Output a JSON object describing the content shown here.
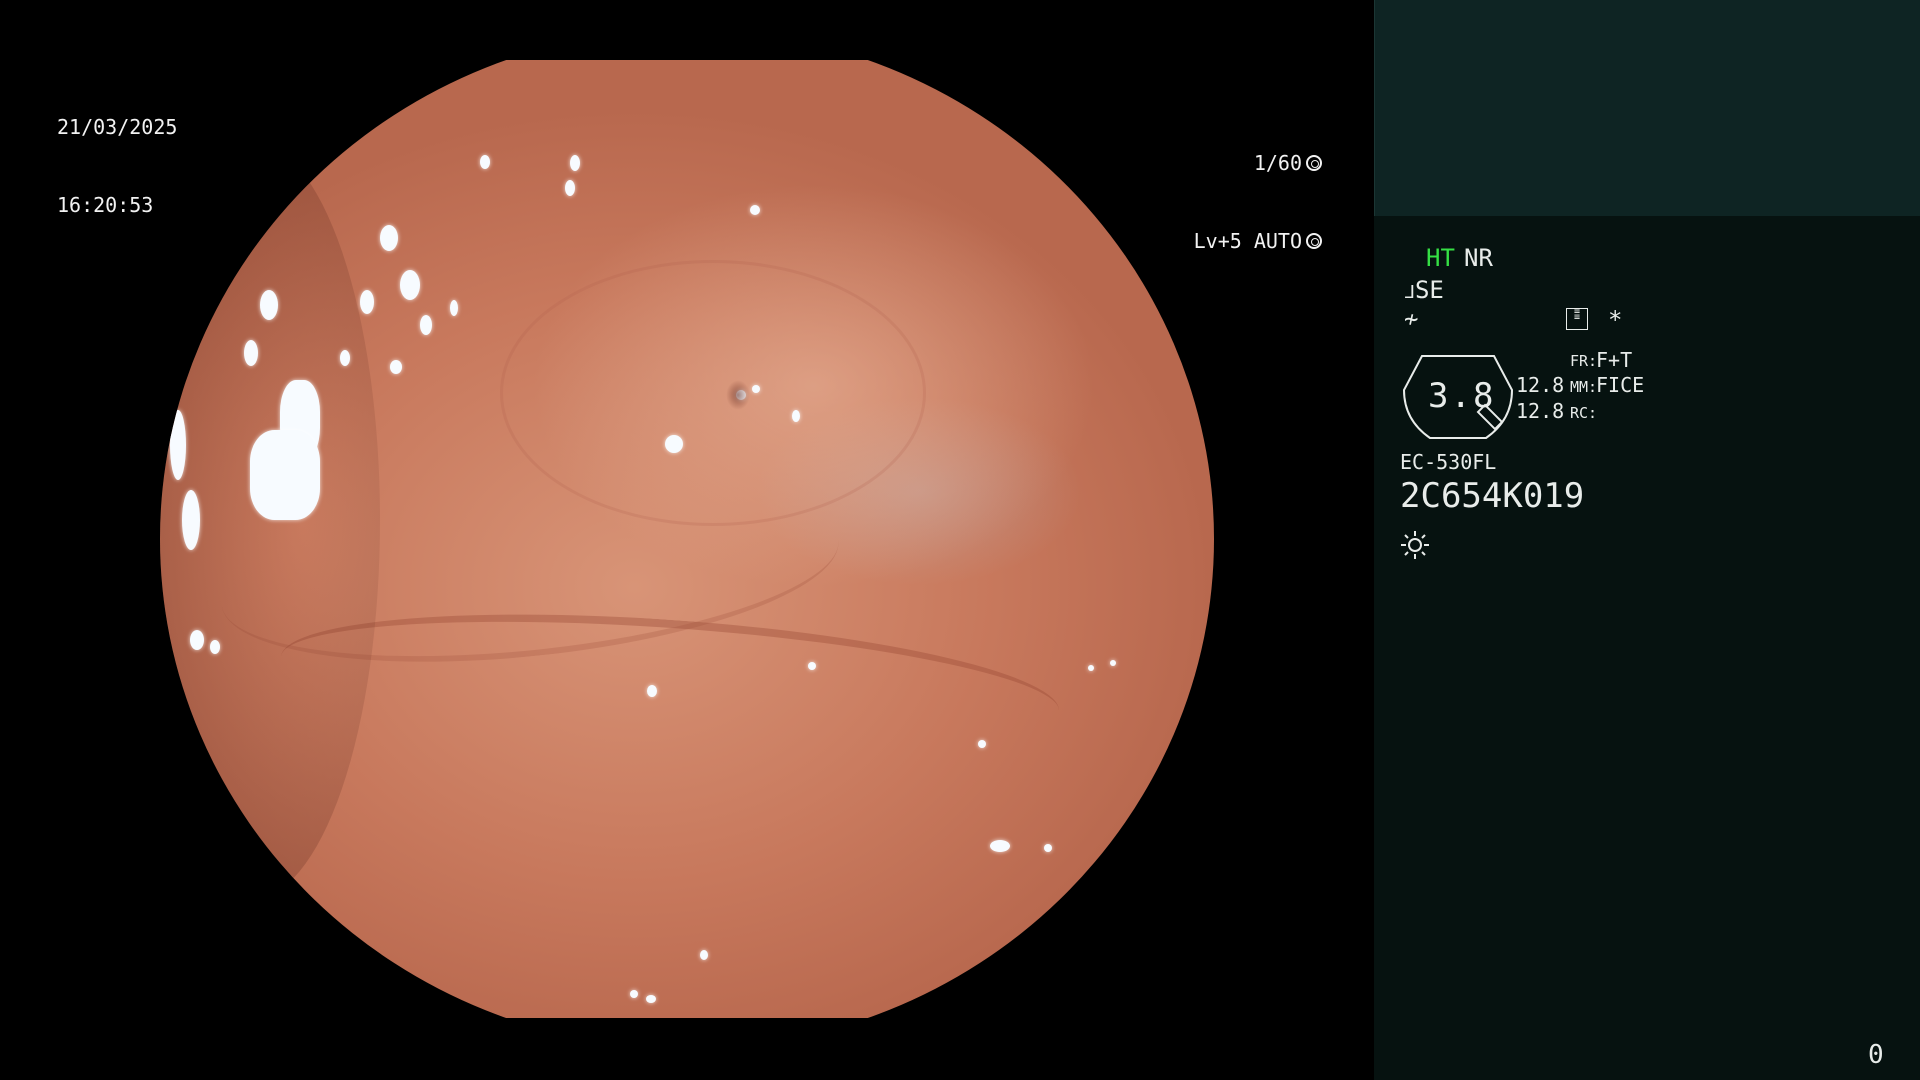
{
  "video": {
    "date": "21/03/2025",
    "time": "16:20:53",
    "shutter_speed": "1/60",
    "level_mode": "Lv+5 AUTO"
  },
  "panel": {
    "mode_ht": "HT",
    "mode_nr": "NR",
    "se_label": "SE",
    "asterisk": "*",
    "zoom_value": "3.8",
    "param_top": "12.8",
    "param_bottom": "12.8",
    "fr_label": "FR:",
    "fr_value": "F+T",
    "mm_label": "MM:",
    "mm_value": "FICE",
    "rc_label": "RC:",
    "scope_model": "EC-530FL",
    "scope_serial": "2C654K019",
    "counter": "0"
  },
  "colors": {
    "panel_bg": "#061210",
    "panel_top_bg": "#0e2423",
    "ht_green": "#35e045",
    "text": "#e8ecea"
  },
  "icons": [
    "shutter-icon",
    "iris-icon",
    "light-sensor-icon",
    "filter-icon",
    "structure-enhance-icon",
    "lamp-icon"
  ]
}
